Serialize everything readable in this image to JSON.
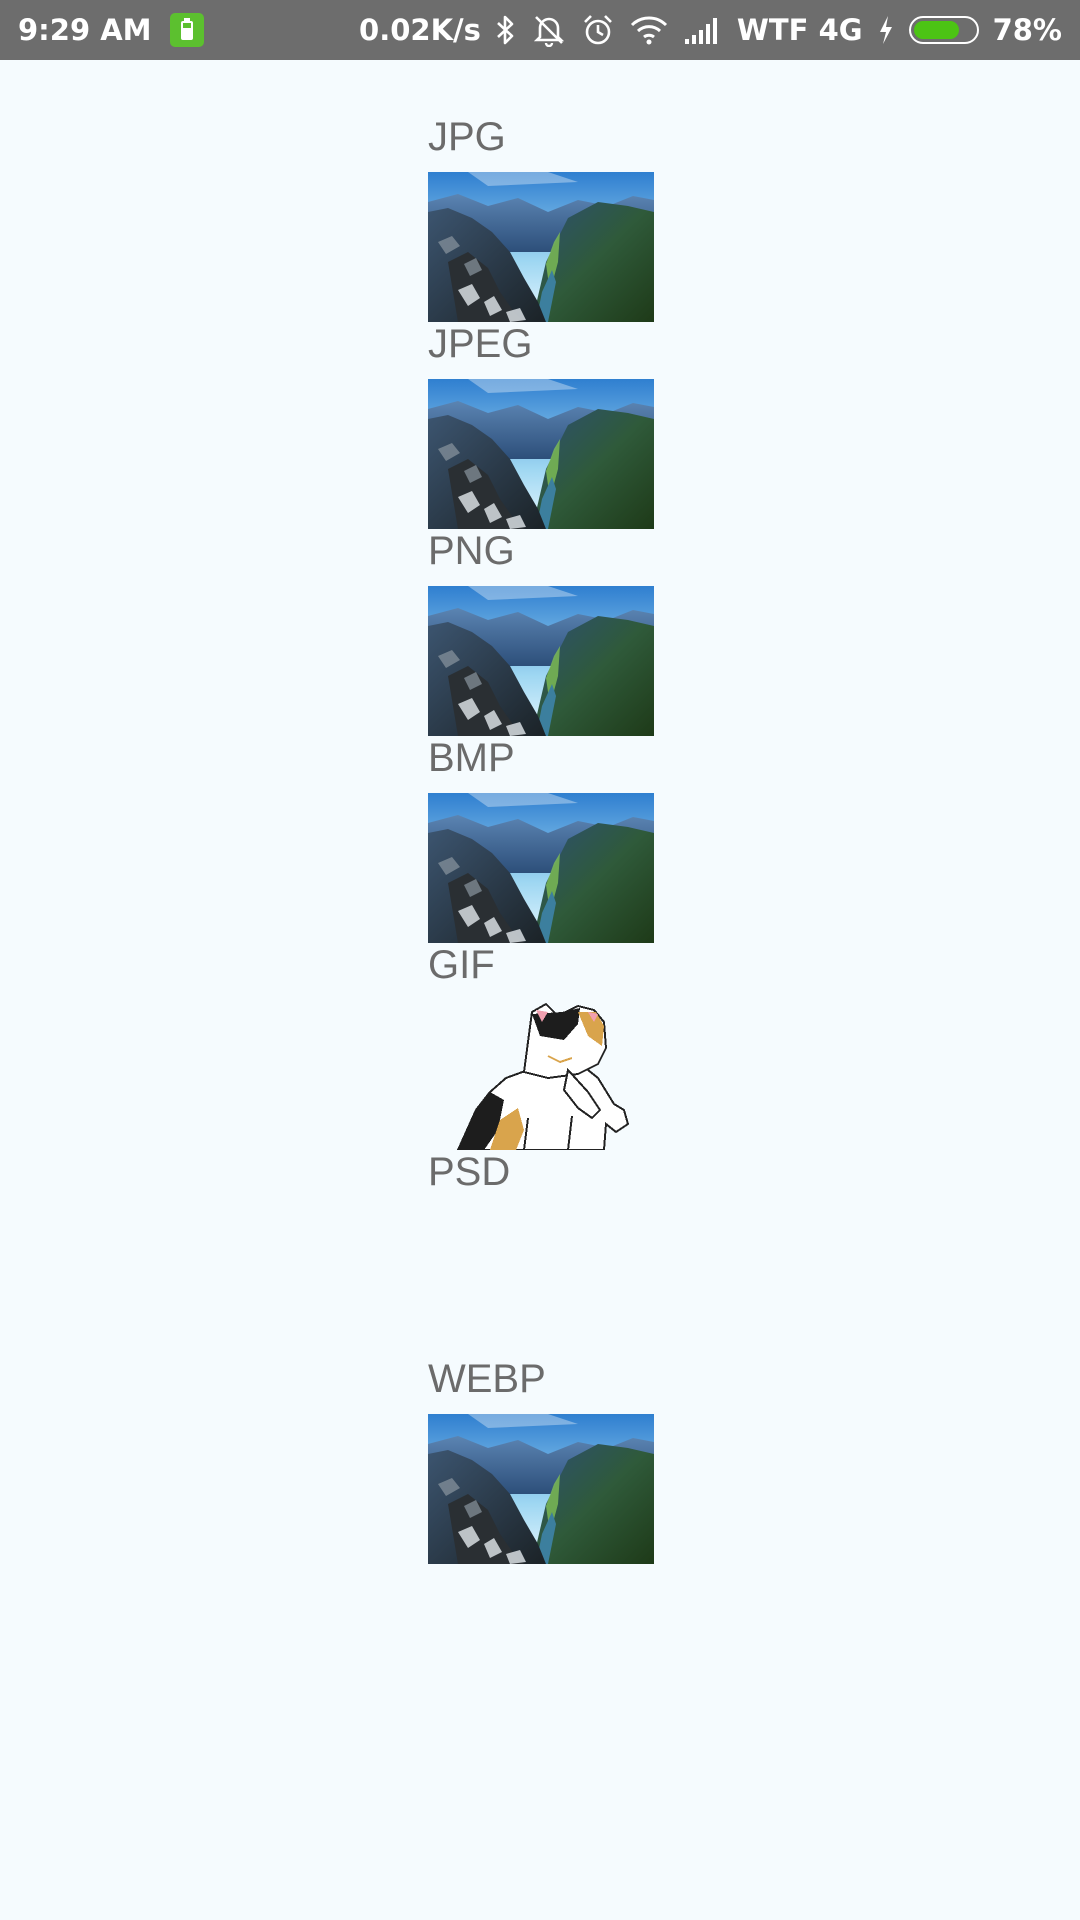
{
  "status_bar": {
    "time": "9:29 AM",
    "net_speed": "0.02K/s",
    "carrier": "WTF 4G",
    "battery_percent": "78%",
    "battery_level": 0.78,
    "icons": [
      "battery-saver-icon",
      "bluetooth-icon",
      "vibrate-off-icon",
      "alarm-icon",
      "wifi-icon",
      "signal-icon",
      "charging-bolt-icon",
      "battery-icon"
    ],
    "colors": {
      "bar": "#6d6d6d",
      "battery_fill": "#4cc414",
      "saver": "#5cc02f"
    }
  },
  "formats": [
    {
      "label": "JPG",
      "image": "landscape-mountain-valley"
    },
    {
      "label": "JPEG",
      "image": "landscape-mountain-valley"
    },
    {
      "label": "PNG",
      "image": "landscape-mountain-valley"
    },
    {
      "label": "BMP",
      "image": "landscape-mountain-valley"
    },
    {
      "label": "GIF",
      "image": "calico-cat-pixel-art"
    },
    {
      "label": "PSD",
      "image": "none"
    },
    {
      "label": "WEBP",
      "image": "landscape-mountain-valley"
    }
  ],
  "colors": {
    "background": "#f5fbfe",
    "label_text": "#6b6b6b"
  }
}
